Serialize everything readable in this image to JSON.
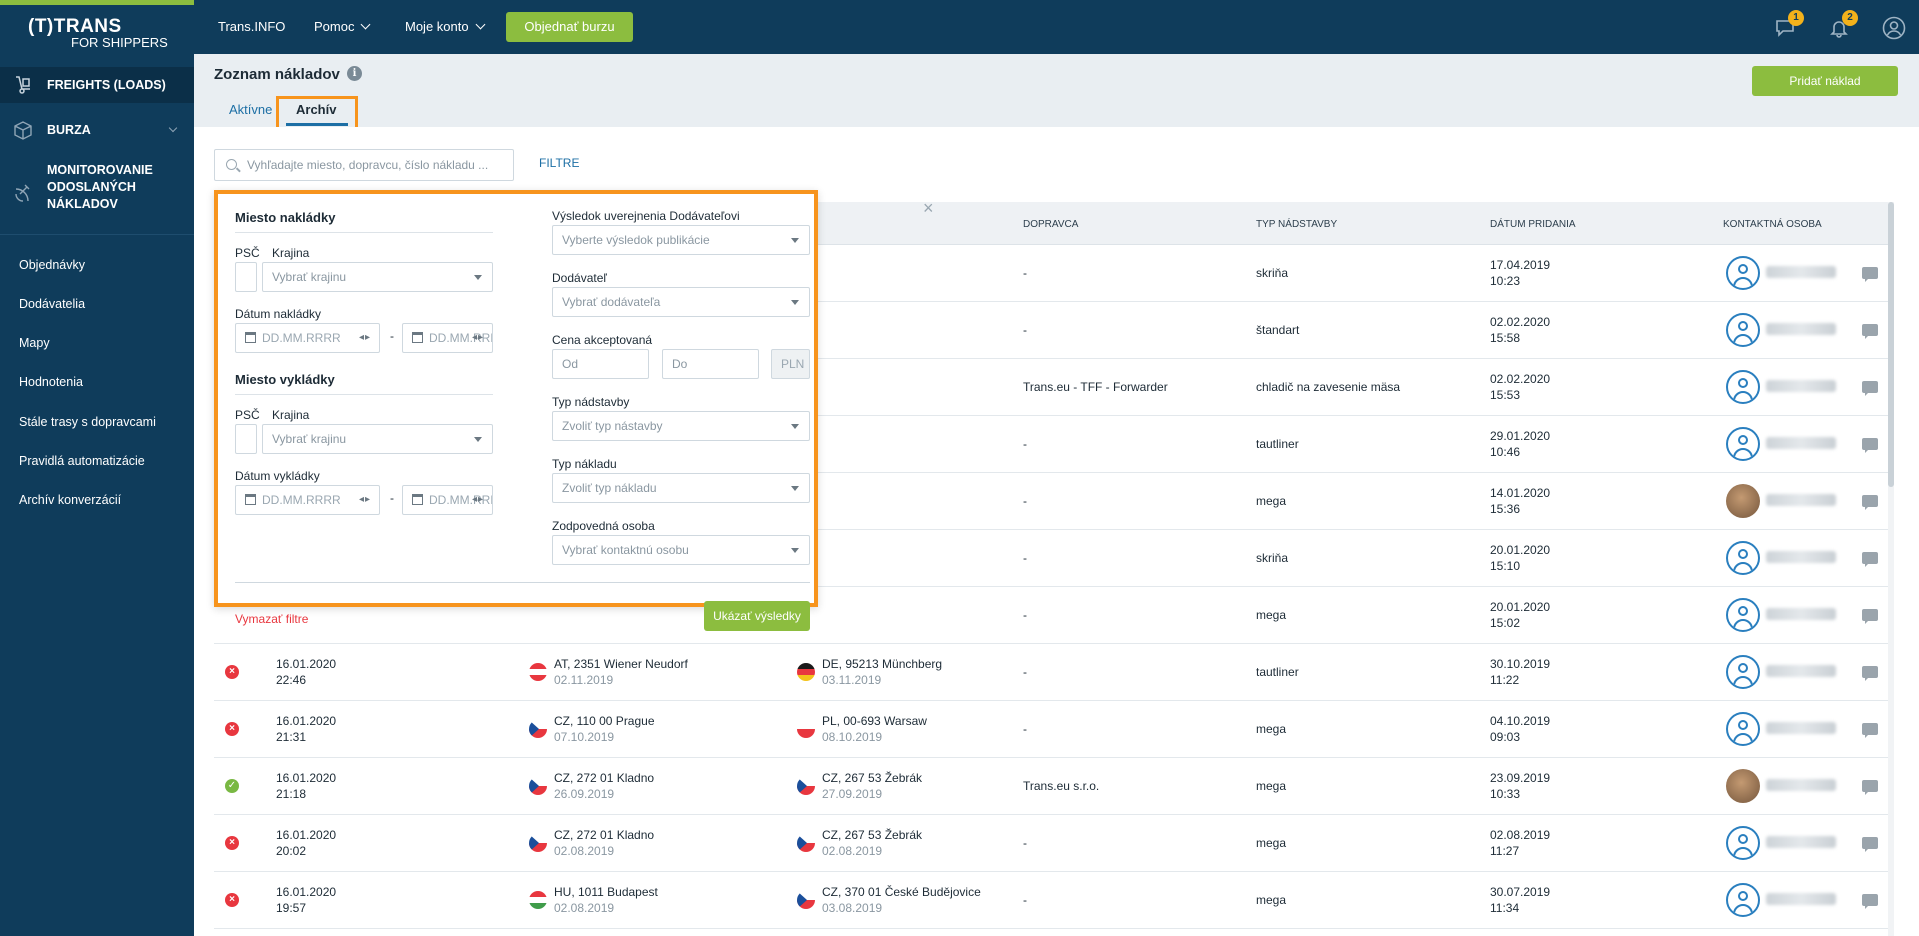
{
  "brand": {
    "line1": "(T)TRANS",
    "line2": "FOR SHIPPERS"
  },
  "topnav": {
    "items": [
      {
        "label": "Trans.INFO"
      },
      {
        "label": "Pomoc"
      },
      {
        "label": "Moje konto"
      }
    ],
    "cta_label": "Objednať burzu",
    "messages_badge": "1",
    "notifications_badge": "2"
  },
  "sidebar": {
    "main": [
      {
        "label": "FREIGHTS (LOADS)",
        "icon": "dolly-icon"
      },
      {
        "label": "BURZA",
        "icon": "box-icon"
      },
      {
        "label": "MONITOROVANIE\nODOSLANÝCH\nNÁKLADOV",
        "icon": "satellite-icon"
      }
    ],
    "sub": [
      {
        "label": "Objednávky"
      },
      {
        "label": "Dodávatelia"
      },
      {
        "label": "Mapy"
      },
      {
        "label": "Hodnotenia"
      },
      {
        "label": "Stále trasy s dopravcami"
      },
      {
        "label": "Pravidlá automatizácie"
      },
      {
        "label": "Archív konverzácií"
      }
    ]
  },
  "page": {
    "title": "Zoznam nákladov",
    "add_button": "Pridať náklad",
    "tabs": [
      {
        "label": "Aktívne"
      },
      {
        "label": "Archív"
      }
    ],
    "active_tab": "Archív",
    "search_placeholder": "Vyhľadajte miesto, dopravcu, číslo nákladu ...",
    "filter_link": "FILTRE"
  },
  "table": {
    "headers": {
      "carrier": "DOPRAVCA",
      "body_type": "TYP NÁDSTAVBY",
      "date_added": "DÁTUM PRIDANIA",
      "contact": "KONTAKTNÁ OSOBA"
    },
    "rows": [
      {
        "carrier": "-",
        "body": "skriňa",
        "added_date": "17.04.2019",
        "added_time": "10:23",
        "avatar": "outline"
      },
      {
        "carrier": "-",
        "body": "štandart",
        "added_date": "02.02.2020",
        "added_time": "15:58",
        "avatar": "outline"
      },
      {
        "carrier": "Trans.eu - TFF - Forwarder",
        "body": "chladič na zavesenie mäsa",
        "added_date": "02.02.2020",
        "added_time": "15:53",
        "avatar": "outline"
      },
      {
        "carrier": "-",
        "body": "tautliner",
        "added_date": "29.01.2020",
        "added_time": "10:46",
        "avatar": "outline"
      },
      {
        "carrier": "-",
        "body": "mega",
        "added_date": "14.01.2020",
        "added_time": "15:36",
        "avatar": "photo"
      },
      {
        "carrier": "-",
        "body": "skriňa",
        "added_date": "20.01.2020",
        "added_time": "15:10",
        "avatar": "outline"
      },
      {
        "carrier": "-",
        "body": "mega",
        "added_date": "20.01.2020",
        "added_time": "15:02",
        "avatar": "outline"
      },
      {
        "status": "error",
        "date": "16.01.2020",
        "time": "22:46",
        "from_flag": "at",
        "from": "AT, 2351 Wiener Neudorf",
        "from_date": "02.11.2019",
        "to_flag": "de",
        "to": "DE, 95213 Münchberg",
        "to_date": "03.11.2019",
        "carrier": "-",
        "body": "tautliner",
        "added_date": "30.10.2019",
        "added_time": "11:22",
        "avatar": "outline"
      },
      {
        "status": "error",
        "date": "16.01.2020",
        "time": "21:31",
        "from_flag": "cz",
        "from": "CZ, 110 00 Prague",
        "from_date": "07.10.2019",
        "to_flag": "pl",
        "to": "PL, 00-693 Warsaw",
        "to_date": "08.10.2019",
        "carrier": "-",
        "body": "mega",
        "added_date": "04.10.2019",
        "added_time": "09:03",
        "avatar": "outline"
      },
      {
        "status": "ok",
        "date": "16.01.2020",
        "time": "21:18",
        "from_flag": "cz",
        "from": "CZ, 272 01 Kladno",
        "from_date": "26.09.2019",
        "to_flag": "cz",
        "to": "CZ, 267 53 Žebrák",
        "to_date": "27.09.2019",
        "carrier": "Trans.eu s.r.o.",
        "body": "mega",
        "added_date": "23.09.2019",
        "added_time": "10:33",
        "avatar": "photo"
      },
      {
        "status": "error",
        "date": "16.01.2020",
        "time": "20:02",
        "from_flag": "cz",
        "from": "CZ, 272 01 Kladno",
        "from_date": "02.08.2019",
        "to_flag": "cz",
        "to": "CZ, 267 53 Žebrák",
        "to_date": "02.08.2019",
        "carrier": "-",
        "body": "mega",
        "added_date": "02.08.2019",
        "added_time": "11:27",
        "avatar": "outline"
      },
      {
        "status": "error",
        "date": "16.01.2020",
        "time": "19:57",
        "from_flag": "hu",
        "from": "HU, 1011 Budapest",
        "from_date": "02.08.2019",
        "to_flag": "cz",
        "to": "CZ, 370 01 České Budějovice",
        "to_date": "03.08.2019",
        "carrier": "-",
        "body": "mega",
        "added_date": "30.07.2019",
        "added_time": "11:34",
        "avatar": "outline"
      }
    ]
  },
  "filter_panel": {
    "loading_title": "Miesto nakládky",
    "psc_label": "PSČ",
    "country_label": "Krajina",
    "country_placeholder": "Vybrať krajinu",
    "loading_date_label": "Dátum nakládky",
    "date_placeholder": "DD.MM.RRRR",
    "unloading_title": "Miesto vykládky",
    "unloading_date_label": "Dátum vykládky",
    "result_label": "Výsledok uverejnenia Dodávateľovi",
    "result_placeholder": "Vyberte výsledok publikácie",
    "supplier_label": "Dodávateľ",
    "supplier_placeholder": "Vybrať dodávateľa",
    "price_label": "Cena akceptovaná",
    "price_from": "Od",
    "price_to": "Do",
    "currency": "PLN",
    "body_label": "Typ nádstavby",
    "body_placeholder": "Zvoliť typ nástavby",
    "load_type_label": "Typ nákladu",
    "load_type_placeholder": "Zvoliť typ nákladu",
    "responsible_label": "Zodpovedná osoba",
    "responsible_placeholder": "Vybrať kontaktnú osobu",
    "clear_label": "Vymazať filtre",
    "show_label": "Ukázať výsledky",
    "dash": "-",
    "close": "×"
  },
  "colors": {
    "navy": "#0f3c5b",
    "green": "#8cbd3f",
    "highlight": "#f7941d",
    "error": "#e8373f",
    "ok": "#79b843",
    "link": "#1d6fa5"
  }
}
